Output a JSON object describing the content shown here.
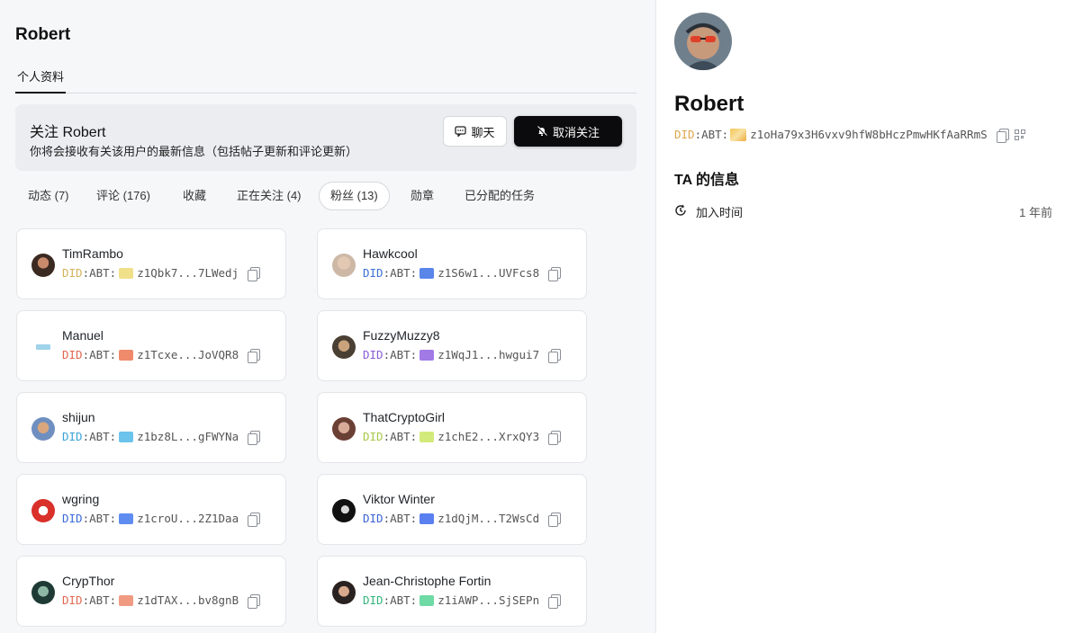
{
  "page_title": "Robert",
  "main_tab": "个人资料",
  "follow": {
    "title": "关注 Robert",
    "description": "你将会接收有关该用户的最新信息（包括帖子更新和评论更新）",
    "chat_label": "聊天",
    "unfollow_label": "取消关注"
  },
  "subtabs": [
    {
      "label": "动态 (7)"
    },
    {
      "label": "评论 (176)"
    },
    {
      "label": "收藏"
    },
    {
      "label": "正在关注 (4)"
    },
    {
      "label": "粉丝 (13)",
      "active": true
    },
    {
      "label": "勋章"
    },
    {
      "label": "已分配的任务"
    }
  ],
  "followers": [
    {
      "name": "TimRambo",
      "did_prefix": "DID",
      "did_rest": ":ABT:",
      "did_short": "z1Qbk7...7LWedj",
      "color": "#d4b25a",
      "chip": "#f1e08a"
    },
    {
      "name": "Hawkcool",
      "did_prefix": "DID",
      "did_rest": ":ABT:",
      "did_short": "z1S6w1...UVFcs8",
      "color": "#3b6fd8",
      "chip": "#5a86ea"
    },
    {
      "name": "Manuel",
      "did_prefix": "DID",
      "did_rest": ":ABT:",
      "did_short": "z1Tcxe...JoVQR8",
      "color": "#e0664f",
      "chip": "#ef8a6a"
    },
    {
      "name": "FuzzyMuzzy8",
      "did_prefix": "DID",
      "did_rest": ":ABT:",
      "did_short": "z1WqJ1...hwgui7",
      "color": "#8b5cd8",
      "chip": "#a17ae6"
    },
    {
      "name": "shijun",
      "did_prefix": "DID",
      "did_rest": ":ABT:",
      "did_short": "z1bz8L...gFWYNa",
      "color": "#3aa3d8",
      "chip": "#6cc3ec"
    },
    {
      "name": "ThatCryptoGirl",
      "did_prefix": "DID",
      "did_rest": ":ABT:",
      "did_short": "z1chE2...XrxQY3",
      "color": "#a8c94a",
      "chip": "#d2ea7a"
    },
    {
      "name": "wgring",
      "did_prefix": "DID",
      "did_rest": ":ABT:",
      "did_short": "z1croU...2Z1Daa",
      "color": "#3a6ad8",
      "chip": "#5f8cf0"
    },
    {
      "name": "Viktor Winter",
      "did_prefix": "DID",
      "did_rest": ":ABT:",
      "did_short": "z1dQjM...T2WsCd",
      "color": "#3a62d6",
      "chip": "#5a7ff0"
    },
    {
      "name": "CrypThor",
      "did_prefix": "DID",
      "did_rest": ":ABT:",
      "did_short": "z1dTAX...bv8gnB",
      "color": "#e06a52",
      "chip": "#f09a82"
    },
    {
      "name": "Jean-Christophe Fortin",
      "did_prefix": "DID",
      "did_rest": ":ABT:",
      "did_short": "z1iAWP...SjSEPn",
      "color": "#2fb679",
      "chip": "#6fdaa5"
    }
  ],
  "profile": {
    "name": "Robert",
    "did_prefix": "DID",
    "did_rest": ":ABT:",
    "did_full": "z1oHa79x3H6vxv9hfW8bHczPmwHKfAaRRmS",
    "did_color": "#e0a64a",
    "section_title": "TA 的信息",
    "join_label": "加入时间",
    "join_value": "1 年前"
  },
  "icons": {
    "chat": "chat-bubble-icon",
    "bell": "bell-off-icon",
    "copy": "copy-icon",
    "qr": "qr-code-icon",
    "clock": "clock-icon"
  }
}
